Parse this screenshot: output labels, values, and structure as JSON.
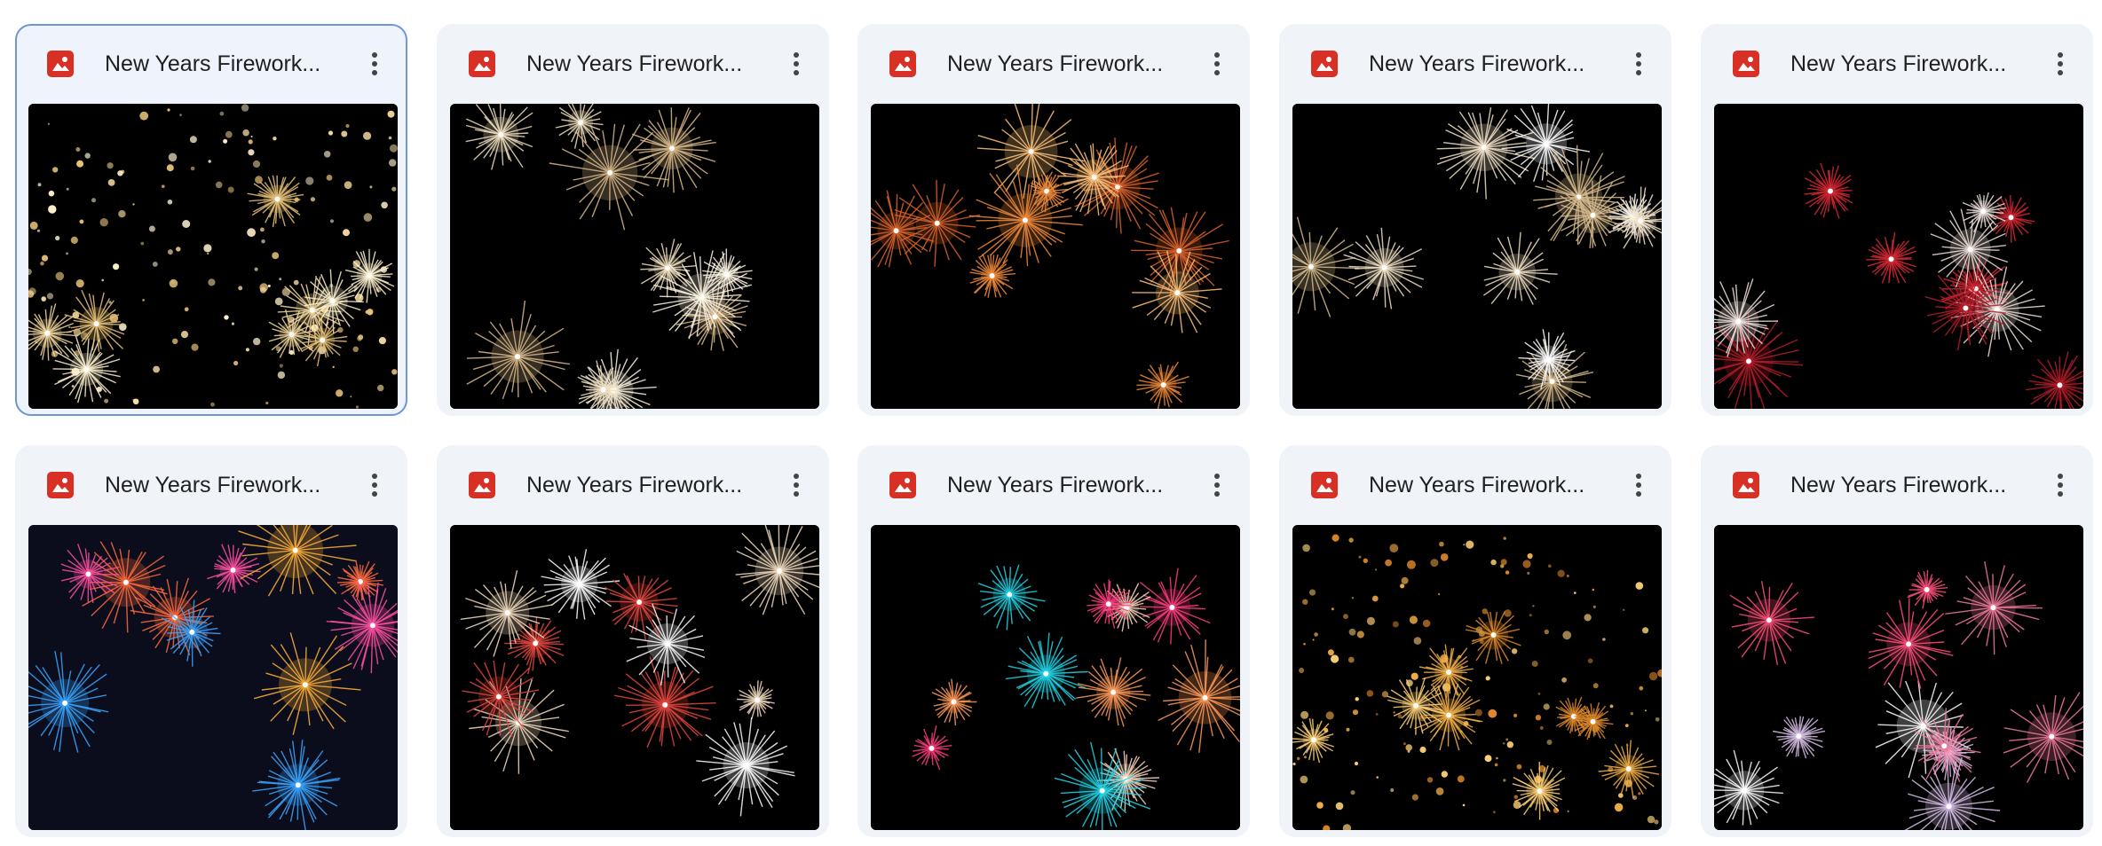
{
  "files": [
    {
      "title": "New Years Firework...",
      "icon": "image-file-icon",
      "selected": true,
      "palette": [
        "#f4d9a0",
        "#e8c27a",
        "#fff2cf"
      ],
      "style": "dots"
    },
    {
      "title": "New Years Firework...",
      "icon": "image-file-icon",
      "selected": false,
      "palette": [
        "#f1dfbf",
        "#d9b98a",
        "#fff6e4"
      ],
      "style": "bursts"
    },
    {
      "title": "New Years Firework...",
      "icon": "image-file-icon",
      "selected": false,
      "palette": [
        "#f08a3a",
        "#d9622a",
        "#ffc27a"
      ],
      "style": "bursts"
    },
    {
      "title": "New Years Firework...",
      "icon": "image-file-icon",
      "selected": false,
      "palette": [
        "#f3e3c8",
        "#d8bb8e",
        "#ffffff"
      ],
      "style": "bursts"
    },
    {
      "title": "New Years Firework...",
      "icon": "image-file-icon",
      "selected": false,
      "palette": [
        "#d62834",
        "#f0e2dc",
        "#b31d2a"
      ],
      "style": "bursts"
    },
    {
      "title": "New Years Firework...",
      "icon": "image-file-icon",
      "selected": false,
      "palette": [
        "#ff6a3d",
        "#3aa5ff",
        "#ff4fa0",
        "#ffb238"
      ],
      "style": "bursts",
      "background": "#0b0d1c"
    },
    {
      "title": "New Years Firework...",
      "icon": "image-file-icon",
      "selected": false,
      "palette": [
        "#f3dcc0",
        "#e2473f",
        "#ffffff"
      ],
      "style": "bursts"
    },
    {
      "title": "New Years Firework...",
      "icon": "image-file-icon",
      "selected": false,
      "palette": [
        "#21d6e8",
        "#ff3d7f",
        "#ff9a5a",
        "#ffd9c0"
      ],
      "style": "bursts"
    },
    {
      "title": "New Years Firework...",
      "icon": "image-file-icon",
      "selected": false,
      "palette": [
        "#f3b04a",
        "#ffd27a",
        "#e08a2a"
      ],
      "style": "dots"
    },
    {
      "title": "New Years Firework...",
      "icon": "image-file-icon",
      "selected": false,
      "palette": [
        "#f07a9a",
        "#d9c0e8",
        "#ff4f7a",
        "#ffffff"
      ],
      "style": "bursts"
    }
  ],
  "menu_icon": "more-vert-icon",
  "accent": "#6f94d8"
}
